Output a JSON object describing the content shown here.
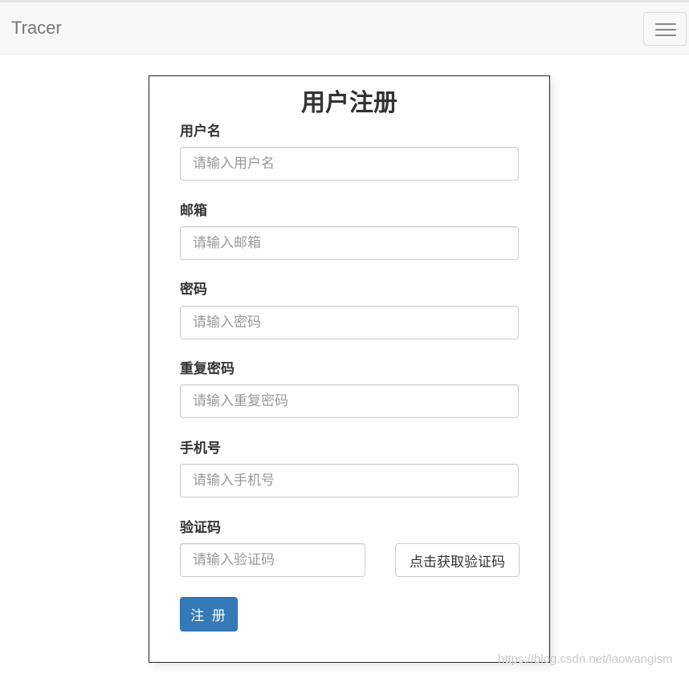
{
  "navbar": {
    "brand": "Tracer",
    "toggle_icon": "hamburger-menu-icon"
  },
  "form": {
    "title": "用户注册",
    "fields": [
      {
        "label": "用户名",
        "placeholder": "请输入用户名"
      },
      {
        "label": "邮箱",
        "placeholder": "请输入邮箱"
      },
      {
        "label": "密码",
        "placeholder": "请输入密码"
      },
      {
        "label": "重复密码",
        "placeholder": "请输入重复密码"
      },
      {
        "label": "手机号",
        "placeholder": "请输入手机号"
      },
      {
        "label": "验证码",
        "placeholder": "请输入验证码"
      }
    ],
    "get_code_label": "点击获取验证码",
    "submit_label": "注 册"
  },
  "watermark": "https://blog.csdn.net/laowangism",
  "colors": {
    "primary": "#337ab7",
    "navbar_bg": "#f8f8f8",
    "brand_text": "#777777"
  }
}
